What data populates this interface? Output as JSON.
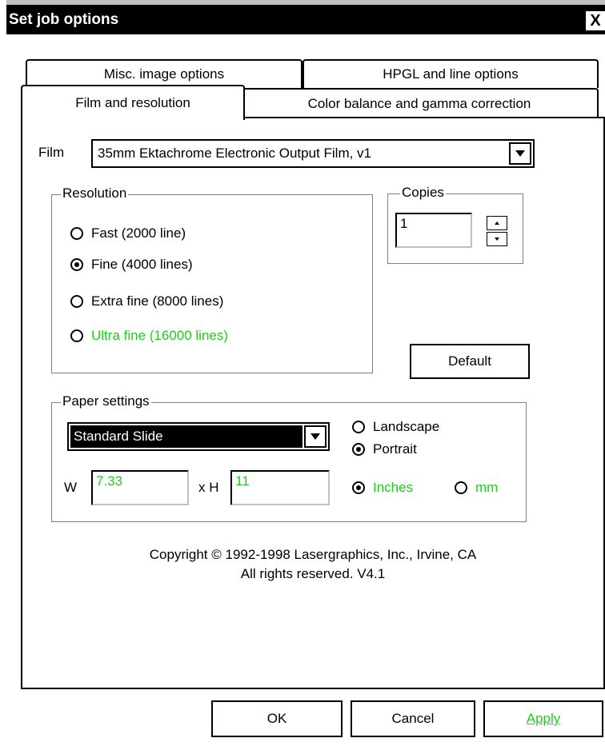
{
  "window": {
    "title": "Set job options",
    "close_glyph": "X"
  },
  "tabs": {
    "row_back": [
      "Misc. image options",
      "HPGL and line options"
    ],
    "row_front": [
      "Film and resolution",
      "Color balance and gamma correction"
    ],
    "active": "Film and resolution"
  },
  "film": {
    "label": "Film",
    "value": "35mm Ektachrome Electronic Output Film, v1"
  },
  "resolution": {
    "title": "Resolution",
    "options": [
      {
        "label": "Fast (2000 line)",
        "selected": false
      },
      {
        "label": "Fine (4000 lines)",
        "selected": true
      },
      {
        "label": "Extra fine (8000 lines)",
        "selected": false
      },
      {
        "label": "Ultra fine (16000 lines)",
        "selected": false,
        "color": "#22cc22"
      }
    ]
  },
  "copies": {
    "title": "Copies",
    "value": "1"
  },
  "default_button": "Default",
  "paper": {
    "title": "Paper settings",
    "preset": "Standard Slide",
    "orientation": [
      {
        "label": "Landscape",
        "selected": false
      },
      {
        "label": "Portrait",
        "selected": true
      }
    ],
    "width_label": "W",
    "width_value": "7.33",
    "height_label": "x H",
    "height_value": "11",
    "units": [
      {
        "label": "Inches",
        "selected": true
      },
      {
        "label": "mm",
        "selected": false
      }
    ]
  },
  "copyright": {
    "line1": "Copyright © 1992-1998 Lasergraphics, Inc., Irvine, CA",
    "line2": "All rights reserved.  V4.1"
  },
  "buttons": {
    "ok": "OK",
    "cancel": "Cancel",
    "apply": "Apply"
  },
  "colors": {
    "accent_green": "#22cc22",
    "titlebar": "#000000",
    "selection": "#000000"
  }
}
